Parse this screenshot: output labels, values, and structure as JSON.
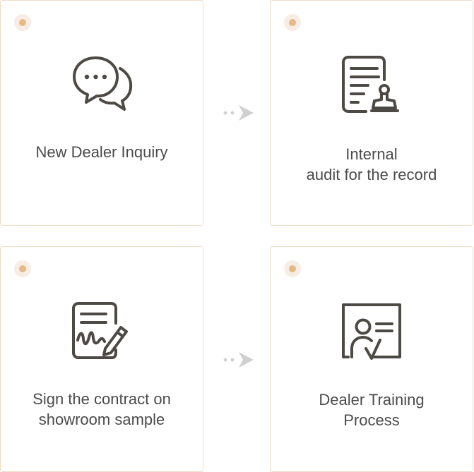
{
  "steps": [
    {
      "label": "New Dealer Inquiry",
      "icon": "chat-bubbles-icon"
    },
    {
      "label": "Internal\naudit for the record",
      "icon": "document-stamp-icon"
    },
    {
      "label": "Sign the contract on\nshowroom sample",
      "icon": "contract-pen-icon"
    },
    {
      "label": "Dealer Training\nProcess",
      "icon": "trainer-board-icon"
    }
  ],
  "colors": {
    "card_border": "#f3dcc6",
    "dot": "#e4ba86",
    "dot_halo": "#f8ede4",
    "icon_stroke": "#4d4a45",
    "text": "#4b4b4b",
    "arrow": "#d0d0d0"
  }
}
